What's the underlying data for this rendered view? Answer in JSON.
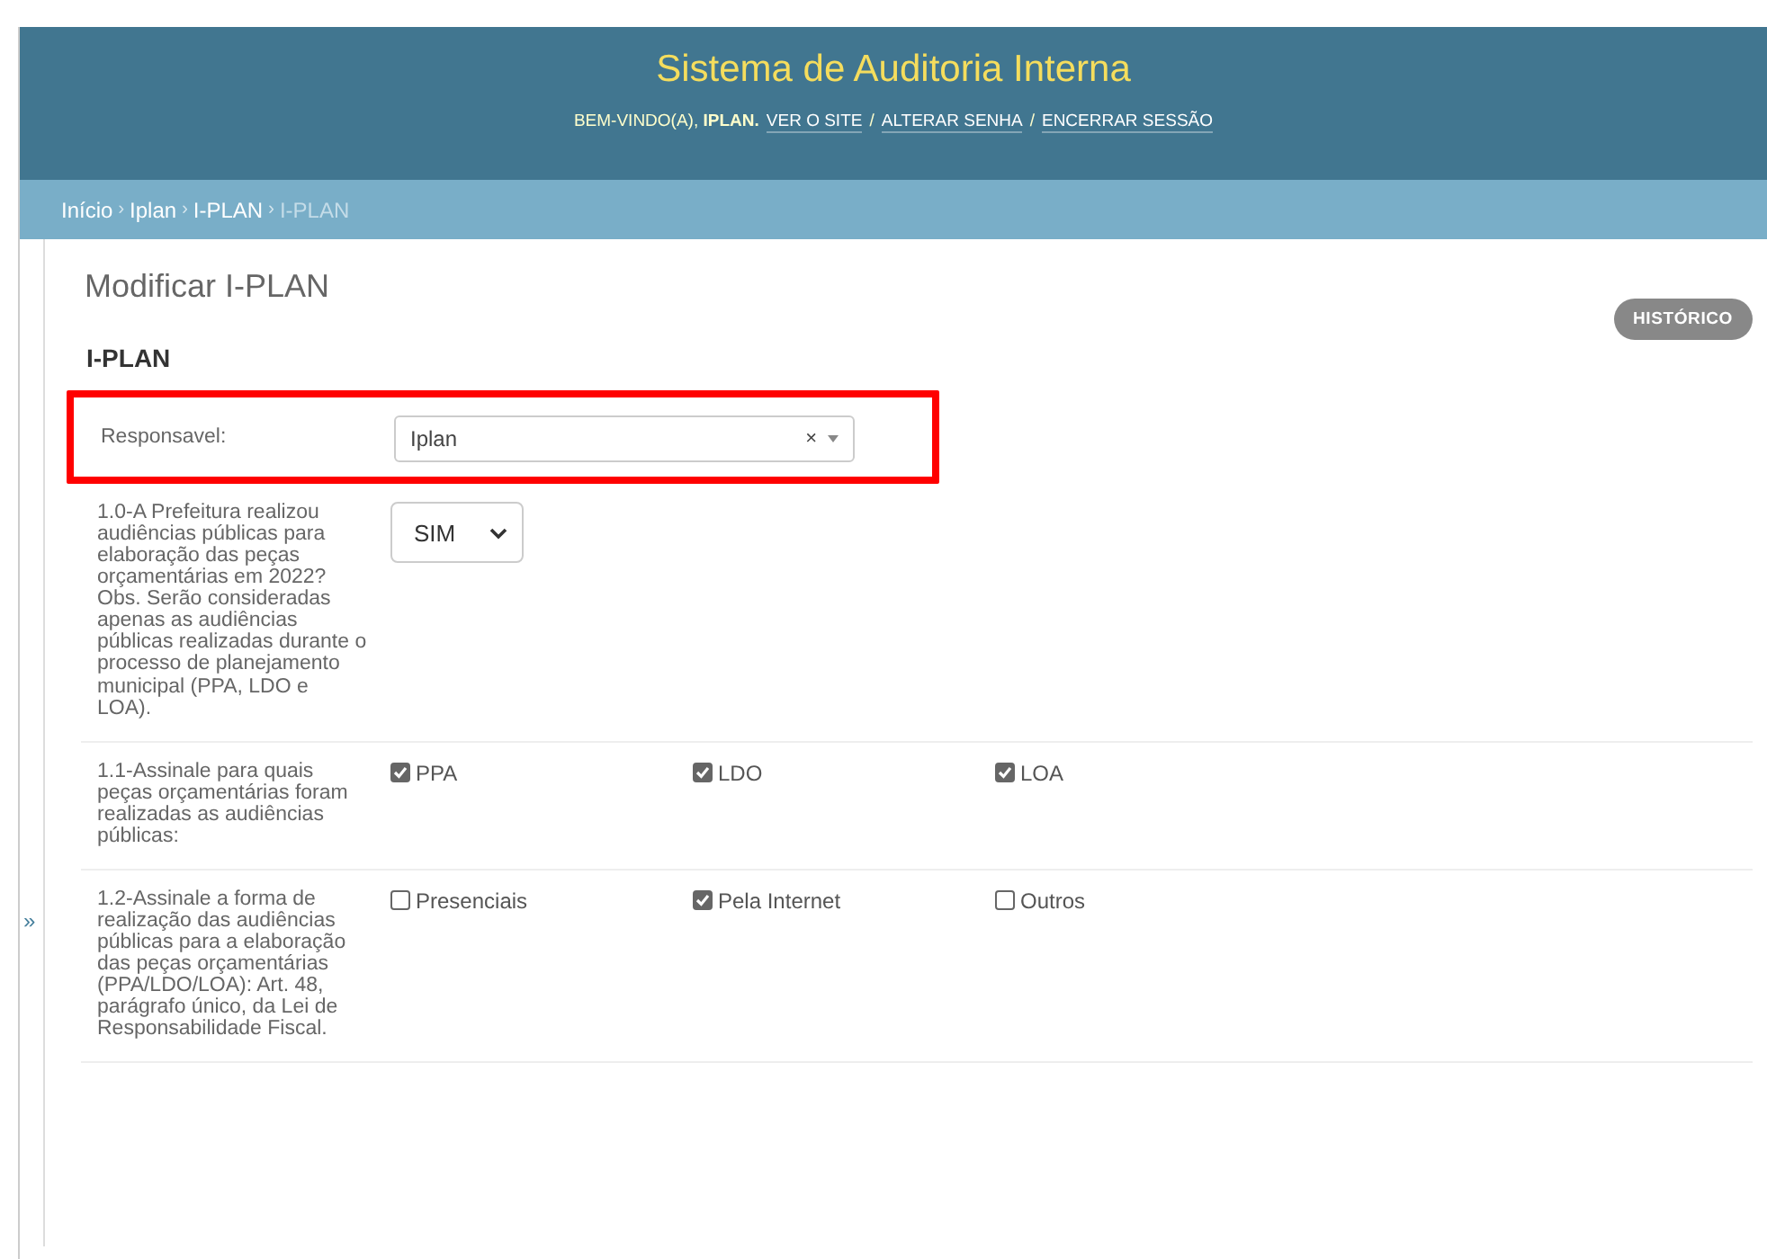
{
  "header": {
    "title": "Sistema de Auditoria Interna",
    "user_tools": [
      {
        "kind": "text",
        "text": "BEM-VINDO(A), **IPLAN.**"
      },
      {
        "kind": "link",
        "text": "VER O SITE"
      },
      {
        "kind": "text",
        "text": "/"
      },
      {
        "kind": "link",
        "text": "ALTERAR SENHA"
      },
      {
        "kind": "text",
        "text": "/"
      },
      {
        "kind": "link",
        "text": "ENCERRAR SESSÃO"
      }
    ]
  },
  "breadcrumbs": [
    {
      "kind": "link",
      "text": "Início"
    },
    {
      "kind": "sep",
      "text": "›"
    },
    {
      "kind": "link",
      "text": "Iplan"
    },
    {
      "kind": "sep",
      "text": "›"
    },
    {
      "kind": "link",
      "text": "I-PLAN"
    },
    {
      "kind": "sep",
      "text": "›"
    },
    {
      "kind": "current",
      "text": "I-PLAN"
    }
  ],
  "sidebar_toggle": "»",
  "page_title": "Modificar I-PLAN",
  "history_button": "HISTÓRICO",
  "fieldset": {
    "title": "I-PLAN",
    "rows": [
      {
        "kind": "select2",
        "label": "Responsavel:",
        "value": "Iplan",
        "clear": "×",
        "highlighted": true
      },
      {
        "kind": "select",
        "label": "1.0-A Prefeitura realizou audiências públicas para elaboração das peças orçamentárias em 2022? Obs. Serão consideradas apenas as audiências públicas realizadas durante o processo de planejamento municipal (PPA, LDO e LOA).",
        "value": "SIM",
        "highlighted": false
      },
      {
        "kind": "checkboxes",
        "label": "1.1-Assinale para quais peças orçamentárias foram realizadas as audiências públicas:",
        "highlighted": false,
        "options": [
          {
            "label": "PPA",
            "checked": true
          },
          {
            "label": "LDO",
            "checked": true
          },
          {
            "label": "LOA",
            "checked": true
          }
        ]
      },
      {
        "kind": "checkboxes",
        "label": "1.2-Assinale a forma de realização das audiências públicas para a elaboração das peças orçamentárias (PPA/LDO/LOA): Art. 48, parágrafo único, da Lei de Responsabilidade Fiscal.",
        "highlighted": false,
        "options": [
          {
            "label": "Presenciais",
            "checked": false
          },
          {
            "label": "Pela Internet",
            "checked": true
          },
          {
            "label": "Outros",
            "checked": false
          }
        ]
      }
    ]
  }
}
